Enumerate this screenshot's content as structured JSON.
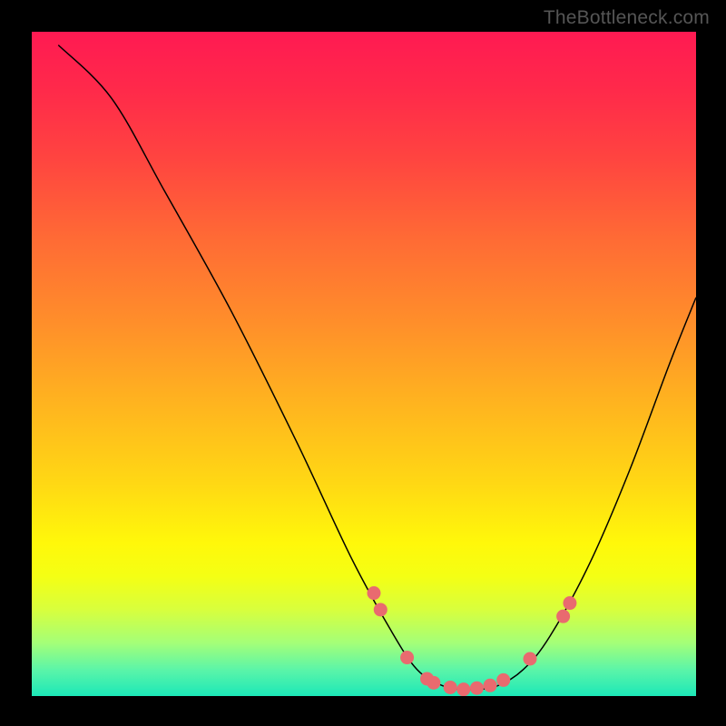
{
  "watermark": "TheBottleneck.com",
  "chart_data": {
    "type": "line",
    "title": "",
    "xlabel": "",
    "ylabel": "",
    "xlim": [
      0,
      100
    ],
    "ylim": [
      0,
      100
    ],
    "curve": [
      {
        "x": 4,
        "y": 98
      },
      {
        "x": 12,
        "y": 90
      },
      {
        "x": 20,
        "y": 76
      },
      {
        "x": 30,
        "y": 58
      },
      {
        "x": 40,
        "y": 38
      },
      {
        "x": 48,
        "y": 21
      },
      {
        "x": 54,
        "y": 10
      },
      {
        "x": 58,
        "y": 4
      },
      {
        "x": 62,
        "y": 1.5
      },
      {
        "x": 66,
        "y": 1
      },
      {
        "x": 70,
        "y": 1.5
      },
      {
        "x": 74,
        "y": 4
      },
      {
        "x": 78,
        "y": 9
      },
      {
        "x": 84,
        "y": 20
      },
      {
        "x": 90,
        "y": 34
      },
      {
        "x": 96,
        "y": 50
      },
      {
        "x": 100,
        "y": 60
      }
    ],
    "markers": [
      {
        "x": 51.5,
        "y": 15.5
      },
      {
        "x": 52.5,
        "y": 13
      },
      {
        "x": 56.5,
        "y": 5.8
      },
      {
        "x": 59.5,
        "y": 2.6
      },
      {
        "x": 60.5,
        "y": 2.0
      },
      {
        "x": 63,
        "y": 1.3
      },
      {
        "x": 65,
        "y": 1.0
      },
      {
        "x": 67,
        "y": 1.2
      },
      {
        "x": 69,
        "y": 1.6
      },
      {
        "x": 71,
        "y": 2.4
      },
      {
        "x": 75,
        "y": 5.6
      },
      {
        "x": 80,
        "y": 12
      },
      {
        "x": 81,
        "y": 14
      }
    ],
    "colors": {
      "curve": "#000000",
      "marker_fill": "#e96a6f",
      "marker_stroke": "#d64a50"
    }
  }
}
